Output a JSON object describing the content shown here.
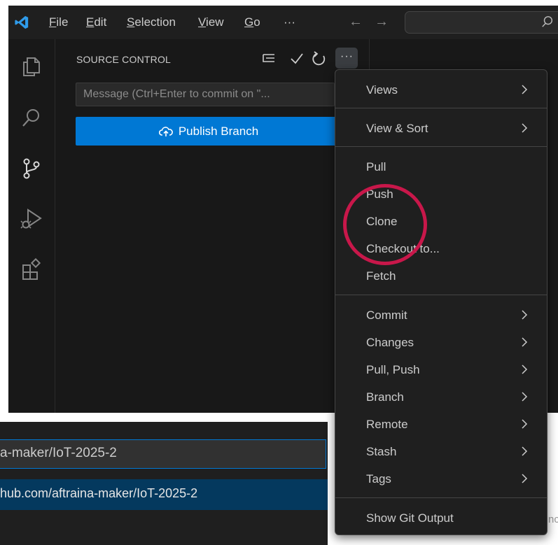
{
  "menubar": {
    "items": [
      "File",
      "Edit",
      "Selection",
      "View",
      "Go"
    ],
    "overflow": "···",
    "back_arrow": "←",
    "forward_arrow": "→"
  },
  "icons": {
    "app": "vscode-logo-icon",
    "search": "search-icon",
    "activity": [
      "explorer-icon",
      "search-icon",
      "source-control-icon",
      "run-debug-icon",
      "extensions-icon"
    ],
    "sc_actions": [
      "view-as-tree-icon",
      "commit-check-icon",
      "refresh-icon"
    ]
  },
  "source_control": {
    "title": "SOURCE CONTROL",
    "more_label": "···",
    "commit_placeholder": "Message (Ctrl+Enter to commit on \"...",
    "publish_label": "Publish Branch"
  },
  "clone_panel": {
    "input_value": "a-maker/IoT-2025-2",
    "option_text": "hub.com/aftraina-maker/IoT-2025-2",
    "edge_label": "nc"
  },
  "context_menu": {
    "items": [
      {
        "label": "Views",
        "submenu": true
      },
      {
        "label": "View & Sort",
        "submenu": true
      },
      {
        "label": "Pull",
        "submenu": false
      },
      {
        "label": "Push",
        "submenu": false
      },
      {
        "label": "Clone",
        "submenu": false
      },
      {
        "label": "Checkout to...",
        "submenu": false
      },
      {
        "label": "Fetch",
        "submenu": false
      },
      {
        "label": "Commit",
        "submenu": true
      },
      {
        "label": "Changes",
        "submenu": true
      },
      {
        "label": "Pull, Push",
        "submenu": true
      },
      {
        "label": "Branch",
        "submenu": true
      },
      {
        "label": "Remote",
        "submenu": true
      },
      {
        "label": "Stash",
        "submenu": true
      },
      {
        "label": "Tags",
        "submenu": true
      },
      {
        "label": "Show Git Output",
        "submenu": false
      }
    ]
  },
  "colors": {
    "accent": "#0078d4",
    "highlight_circle": "#c8174a",
    "background": "#181818"
  }
}
